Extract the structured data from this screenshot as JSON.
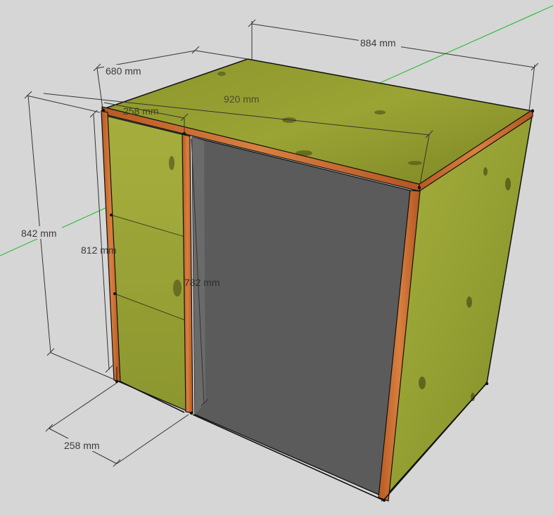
{
  "viewport": {
    "background": "#d6d6d6"
  },
  "colors": {
    "plywood": "#8f9a2e",
    "plywood_dark": "#6d7420",
    "plywood_light": "#b0b846",
    "edge_band": "#c46a2d",
    "opening": "#5b5b5b",
    "axis_green": "#2fbf3a"
  },
  "dimensions": {
    "width_top": "884 mm",
    "depth_top": "680 mm",
    "top_inner_width": "920 mm",
    "drawer_width_top": "258 mm",
    "height_overall": "842 mm",
    "height_inner": "812 mm",
    "opening_height": "782 mm",
    "drawer_width_bottom": "258 mm"
  },
  "model": {
    "object": "cabinet-with-drawers",
    "drawer_count": 3
  }
}
